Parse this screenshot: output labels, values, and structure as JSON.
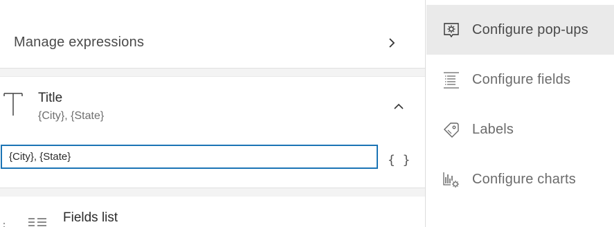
{
  "manage": {
    "label": "Manage expressions"
  },
  "title_block": {
    "heading": "Title",
    "subtitle": "{City}, {State}",
    "input_value": "{City}, {State}",
    "braces": "{ }"
  },
  "fields": {
    "label": "Fields list"
  },
  "menu": {
    "items": [
      {
        "label": "Configure pop-ups",
        "icon": "popup-config-icon",
        "active": true
      },
      {
        "label": "Configure fields",
        "icon": "fields-list-icon",
        "active": false
      },
      {
        "label": "Labels",
        "icon": "label-tag-icon",
        "active": false
      },
      {
        "label": "Configure charts",
        "icon": "chart-config-icon",
        "active": false
      }
    ]
  },
  "colors": {
    "accent": "#1b74b5",
    "active_bg": "#eaeaea",
    "band_bg": "#f3f3f3"
  }
}
